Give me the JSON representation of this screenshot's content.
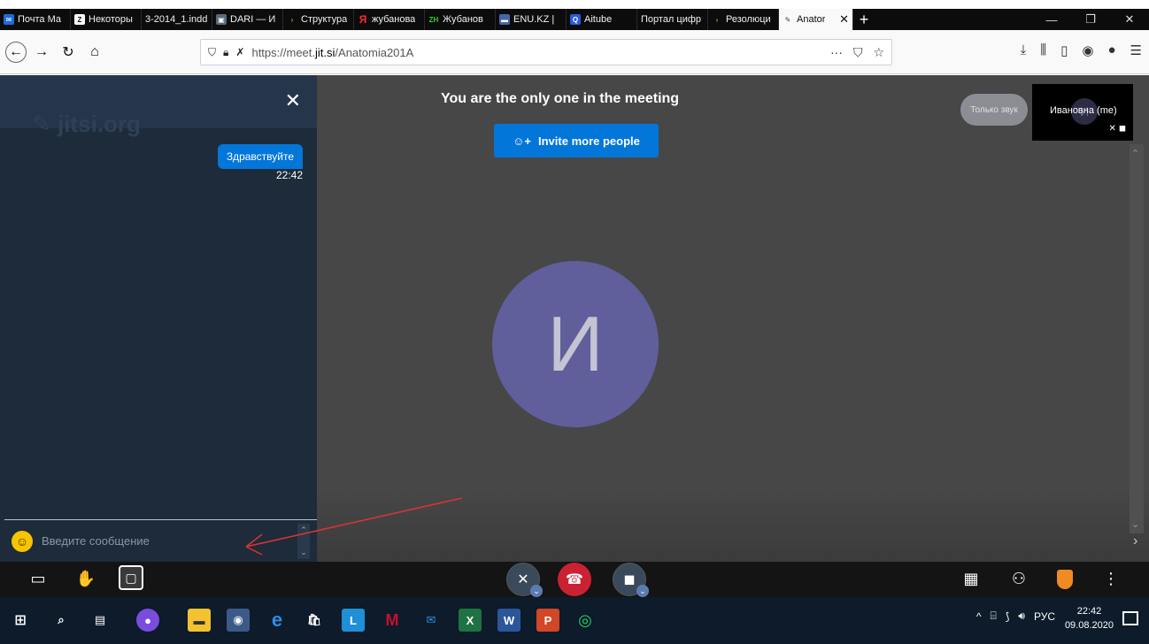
{
  "browser": {
    "tabs": [
      {
        "label": "Почта Ма",
        "color": "#1e6bd6",
        "glyph": "✉"
      },
      {
        "label": "Некоторы",
        "color": "#1a1a1a",
        "glyph": "Z"
      },
      {
        "label": "3-2014_1.indd",
        "color": "#0c0c0d",
        "glyph": ""
      },
      {
        "label": "DARI — И",
        "color": "#5a6a7a",
        "glyph": "▣"
      },
      {
        "label": "Структура",
        "color": "#d07a10",
        "glyph": "›"
      },
      {
        "label": "жубанова",
        "color": "#e02020",
        "glyph": "Я"
      },
      {
        "label": "Жубанов",
        "color": "#22aa22",
        "glyph": "ZH"
      },
      {
        "label": "ENU.KZ |",
        "color": "#4466aa",
        "glyph": "▬"
      },
      {
        "label": "Aitube",
        "color": "#2a5bd7",
        "glyph": "Q"
      },
      {
        "label": "Портал цифр",
        "color": "#0c0c0d",
        "glyph": ""
      },
      {
        "label": "Резолюци",
        "color": "#d07a10",
        "glyph": "›"
      }
    ],
    "active_tab": {
      "label": "Anator",
      "close": "✕"
    },
    "new_tab": "+",
    "url_prefix": "https://meet.",
    "url_domain": "jit.si",
    "url_path": "/Anatomia201A"
  },
  "meeting": {
    "title": "You are the only one in the meeting",
    "invite_label": "Invite more people",
    "avatar_letter": "И",
    "audio_only_label": "Только звук",
    "self_name": "Ивановна (me)"
  },
  "chat": {
    "message": "Здравствуйте",
    "time": "22:42",
    "input_placeholder": "Введите сообщение",
    "close": "✕"
  },
  "taskbar": {
    "lang": "РУС",
    "time": "22:42",
    "date": "09.08.2020"
  },
  "colors": {
    "jitsi_blue": "#0376da",
    "hangup_red": "#cb2233",
    "avatar_purple": "#605f9b",
    "chat_bg": "#1d2b3a"
  }
}
